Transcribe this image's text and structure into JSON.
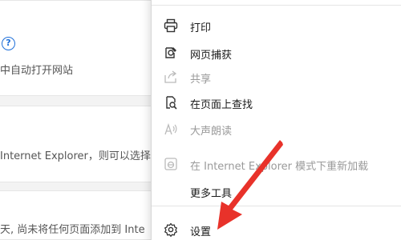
{
  "background": {
    "line1": "中自动打开网站",
    "line2": "Internet Explorer，则可以选择",
    "line3": "天, 尚未将任何页面添加到 Inte"
  },
  "menu": {
    "items": [
      {
        "label": "打印",
        "icon": "print-icon",
        "disabled": false
      },
      {
        "label": "网页捕获",
        "icon": "web-capture-icon",
        "disabled": false
      },
      {
        "label": "共享",
        "icon": "share-icon",
        "disabled": true
      },
      {
        "label": "在页面上查找",
        "icon": "find-on-page-icon",
        "disabled": false
      },
      {
        "label": "大声朗读",
        "icon": "read-aloud-icon",
        "disabled": true
      },
      {
        "label": "在 Internet Explorer 模式下重新加载",
        "icon": "ie-mode-icon",
        "disabled": true
      },
      {
        "label": "更多工具",
        "icon": "",
        "disabled": false
      },
      {
        "label": "设置",
        "icon": "settings-icon",
        "disabled": false
      }
    ]
  },
  "colors": {
    "arrow": "#e8322a",
    "accent": "#1e6fd9"
  }
}
